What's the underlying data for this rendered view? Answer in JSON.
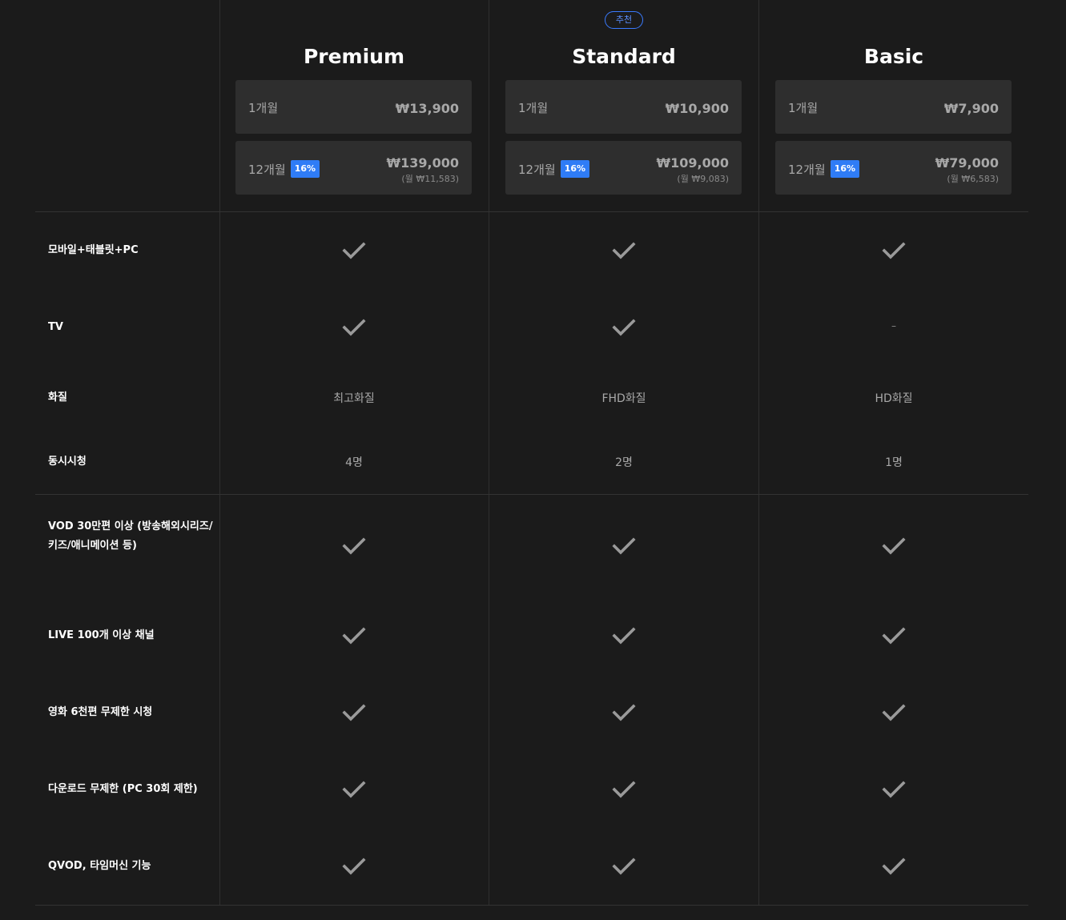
{
  "plans": [
    {
      "name": "Premium",
      "recommended": "",
      "monthly": {
        "period": "1개월",
        "price": "₩13,900"
      },
      "yearly": {
        "period": "12개월",
        "discount": "16%",
        "price": "₩139,000",
        "per_month": "(월 ₩11,583)"
      }
    },
    {
      "name": "Standard",
      "recommended": "추천",
      "monthly": {
        "period": "1개월",
        "price": "₩10,900"
      },
      "yearly": {
        "period": "12개월",
        "discount": "16%",
        "price": "₩109,000",
        "per_month": "(월 ₩9,083)"
      }
    },
    {
      "name": "Basic",
      "recommended": "",
      "monthly": {
        "period": "1개월",
        "price": "₩7,900"
      },
      "yearly": {
        "period": "12개월",
        "discount": "16%",
        "price": "₩79,000",
        "per_month": "(월 ₩6,583)"
      }
    }
  ],
  "features": [
    {
      "label": "모바일+태블릿+PC",
      "values": [
        "check",
        "check",
        "check"
      ]
    },
    {
      "label": "TV",
      "values": [
        "check",
        "check",
        "–"
      ]
    },
    {
      "label": "화질",
      "values": [
        "최고화질",
        "FHD화질",
        "HD화질"
      ]
    },
    {
      "label": "동시시청",
      "values": [
        "4명",
        "2명",
        "1명"
      ]
    },
    {
      "label": "VOD 30만편 이상 (방송해외시리즈/키즈/애니메이션 등)",
      "values": [
        "check",
        "check",
        "check"
      ]
    },
    {
      "label": "LIVE 100개 이상 채널",
      "values": [
        "check",
        "check",
        "check"
      ]
    },
    {
      "label": "영화 6천편 무제한 시청",
      "values": [
        "check",
        "check",
        "check"
      ]
    },
    {
      "label": "다운로드 무제한 (PC 30회 제한)",
      "values": [
        "check",
        "check",
        "check"
      ]
    },
    {
      "label": "QVOD, 타임머신 기능",
      "values": [
        "check",
        "check",
        "check"
      ]
    }
  ],
  "colors": {
    "background": "#1b1b1b",
    "box": "#2e2e2e",
    "accent": "#2f7cf6",
    "muted_text": "#a8a8a8",
    "check_color": "#9a9a9a"
  },
  "icons": {
    "check": "check-icon"
  }
}
